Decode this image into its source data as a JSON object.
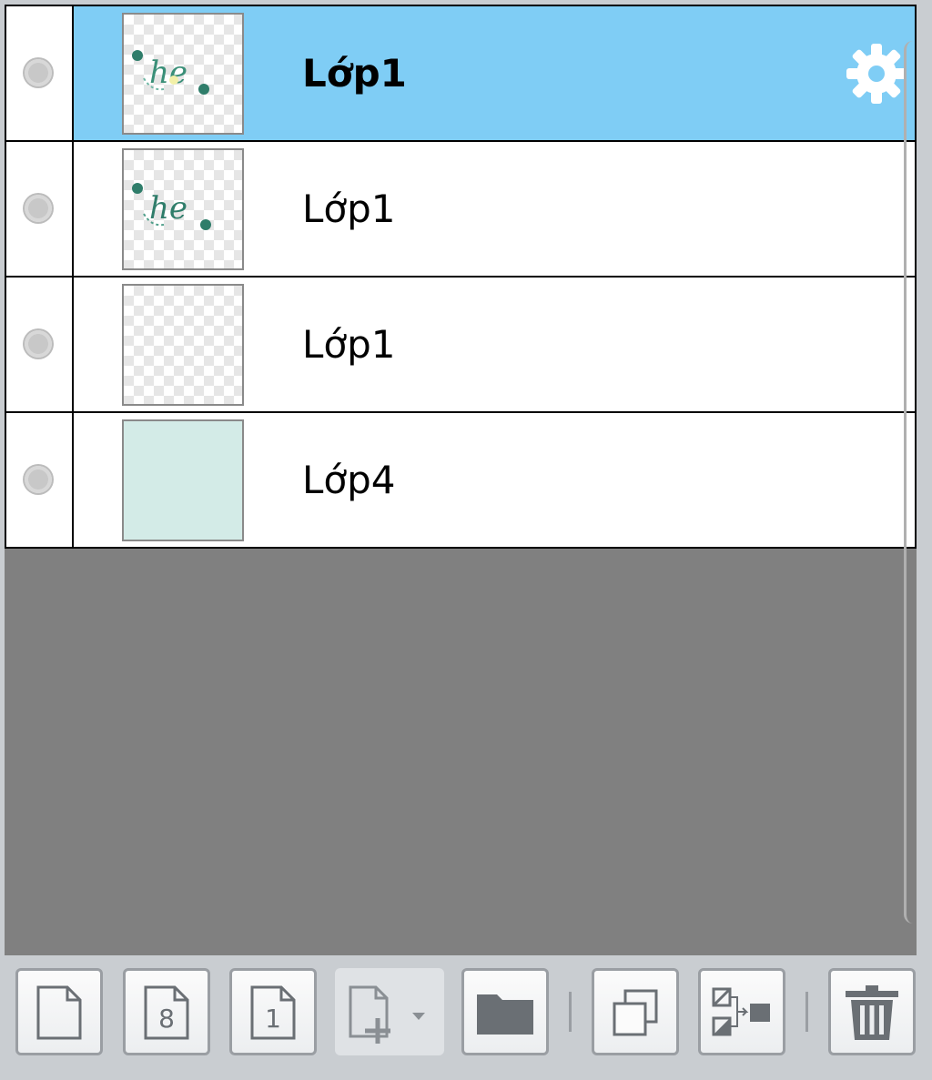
{
  "layers": [
    {
      "name": "Lớp1",
      "selected": true,
      "thumb": "lettering-he",
      "has_gear": true
    },
    {
      "name": "Lớp1",
      "selected": false,
      "thumb": "lettering-he"
    },
    {
      "name": "Lớp1",
      "selected": false,
      "thumb": "transparent"
    },
    {
      "name": "Lớp4",
      "selected": false,
      "thumb": "solid-mint"
    }
  ],
  "toolbar": {
    "buttons": [
      {
        "icon": "new-layer-icon"
      },
      {
        "icon": "new-layer-8bit-icon",
        "glyph": "8"
      },
      {
        "icon": "new-layer-1bit-icon",
        "glyph": "1"
      },
      {
        "icon": "add-layer-dropdown-icon"
      },
      {
        "icon": "folder-icon"
      },
      {
        "icon": "duplicate-layer-icon"
      },
      {
        "icon": "merge-layer-icon"
      },
      {
        "icon": "trash-icon"
      }
    ]
  },
  "colors": {
    "selected_row": "#7fcdf5",
    "panel_bg": "#808080",
    "toolbar_bg": "#c9cdd1",
    "mint_fill": "#d3ebe7",
    "lettering": "#2f7d6a"
  }
}
